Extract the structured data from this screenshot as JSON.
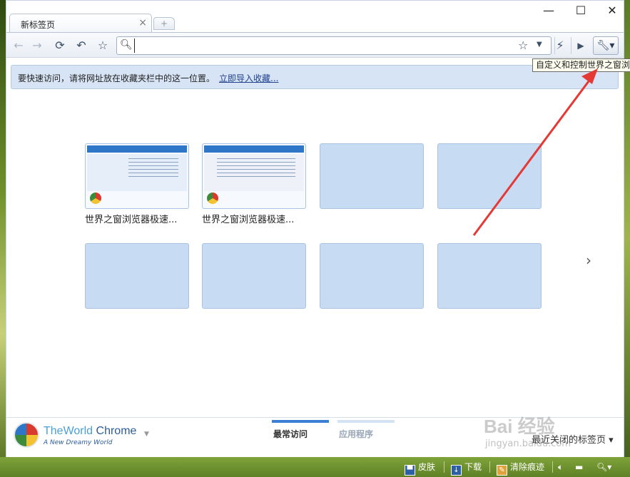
{
  "window": {
    "tab_title": "新标签页",
    "tab_close": "×",
    "newtab_glyph": "+",
    "min_glyph": "—",
    "max_glyph": "☐",
    "close_glyph": "✕"
  },
  "toolbar": {
    "back_glyph": "←",
    "forward_glyph": "→",
    "reload_glyph": "⟳",
    "undo_glyph": "↶",
    "bookmark_glyph": "☆",
    "search_glyph": "🔍︎",
    "omnibox_value": "",
    "star_glyph": "☆",
    "dropdown_glyph": "▼",
    "flash_glyph": "⚡",
    "play_glyph": "▶",
    "wrench_glyph": "🔧︎▾"
  },
  "bookmark_bar": {
    "hint": "要快速访问，请将网址放在收藏夹栏中的这一位置。",
    "import_link": "立即导入收藏..."
  },
  "tooltip": {
    "text": "自定义和控制世界之窗浏览器"
  },
  "thumbnails": [
    {
      "label": "世界之窗浏览器极速..."
    },
    {
      "label": "世界之窗浏览器极速..."
    },
    {
      "label": ""
    },
    {
      "label": ""
    },
    {
      "label": ""
    },
    {
      "label": ""
    },
    {
      "label": ""
    },
    {
      "label": ""
    }
  ],
  "next_arrow": "›",
  "footer": {
    "brand_part1": "TheWorld",
    "brand_part2": " Chrome",
    "brand_tagline": "A New Dreamy World",
    "brand_drop": "▼",
    "tab_most_visited": "最常访问",
    "tab_apps": "应用程序",
    "recently_closed": "最近关闭的标签页 ▾"
  },
  "statusbar": {
    "skin": "皮肤",
    "download": "下载",
    "clear_traces": "清除痕迹"
  },
  "watermark": {
    "main": "Bai 经验",
    "sub": "jingyan.baidu.com"
  },
  "colors": {
    "accent": "#3a7fd3",
    "thumb_empty": "#c7dbf3",
    "statusbar": "#6f9230",
    "arrow": "#e53935"
  }
}
